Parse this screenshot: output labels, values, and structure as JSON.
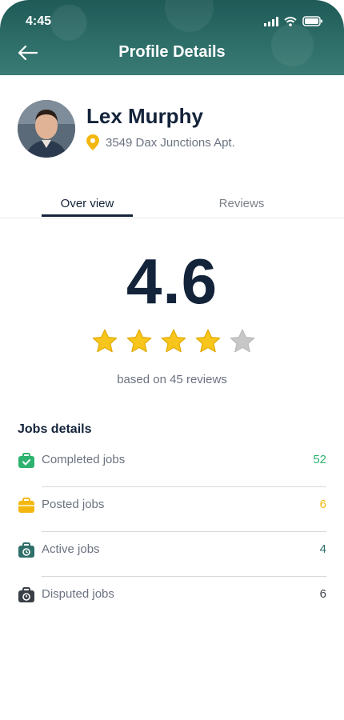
{
  "status_bar": {
    "time": "4:45"
  },
  "header": {
    "title": "Profile Details"
  },
  "profile": {
    "name": "Lex Murphy",
    "address": "3549 Dax Junctions Apt."
  },
  "tabs": [
    {
      "label": "Over view",
      "active": true
    },
    {
      "label": "Reviews",
      "active": false
    }
  ],
  "rating": {
    "value": "4.6",
    "stars_filled": 4,
    "stars_total": 5,
    "reviews_text": "based on 45 reviews"
  },
  "jobs": {
    "title": "Jobs details",
    "items": [
      {
        "label": "Completed jobs",
        "count": "52",
        "color": "#2db36f",
        "icon": "briefcase-check-icon"
      },
      {
        "label": "Posted jobs",
        "count": "6",
        "color": "#f3b70f",
        "icon": "briefcase-icon"
      },
      {
        "label": "Active jobs",
        "count": "4",
        "color": "#2f6f6a",
        "icon": "briefcase-clock-icon"
      },
      {
        "label": "Disputed jobs",
        "count": "6",
        "color": "#3a3f47",
        "icon": "briefcase-alert-icon"
      }
    ]
  },
  "colors": {
    "header": "#2f6f6a",
    "text_dark": "#13233a",
    "star": "#f7c51b",
    "star_empty": "#c7c7c7"
  }
}
